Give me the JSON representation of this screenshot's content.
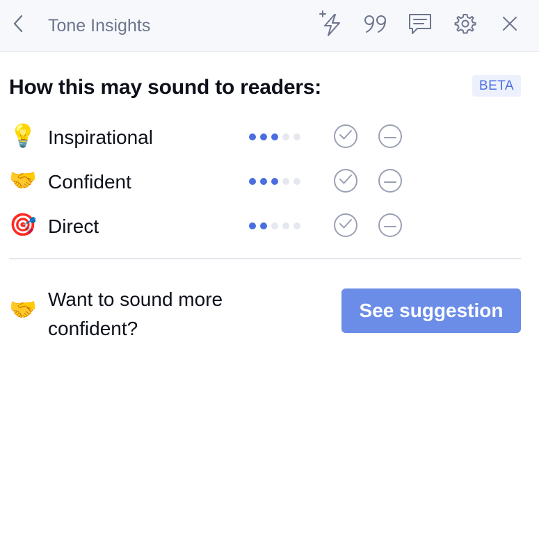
{
  "header": {
    "title": "Tone Insights",
    "icons": [
      "back-icon",
      "lightning-sparkle-icon",
      "quote-icon",
      "comment-icon",
      "gear-icon",
      "close-icon"
    ]
  },
  "main": {
    "heading": "How this may sound to readers:",
    "badge": "BETA",
    "tones": [
      {
        "emoji": "💡",
        "label": "Inspirational",
        "level": 3,
        "max": 5
      },
      {
        "emoji": "🤝",
        "label": "Confident",
        "level": 3,
        "max": 5
      },
      {
        "emoji": "🎯",
        "label": "Direct",
        "level": 2,
        "max": 5
      }
    ]
  },
  "suggestion": {
    "emoji": "🤝",
    "text": "Want to sound more confident?",
    "button_label": "See suggestion"
  },
  "colors": {
    "accent": "#4a6ee0",
    "button": "#6b8de8",
    "header_bg": "#f7f8fc"
  }
}
